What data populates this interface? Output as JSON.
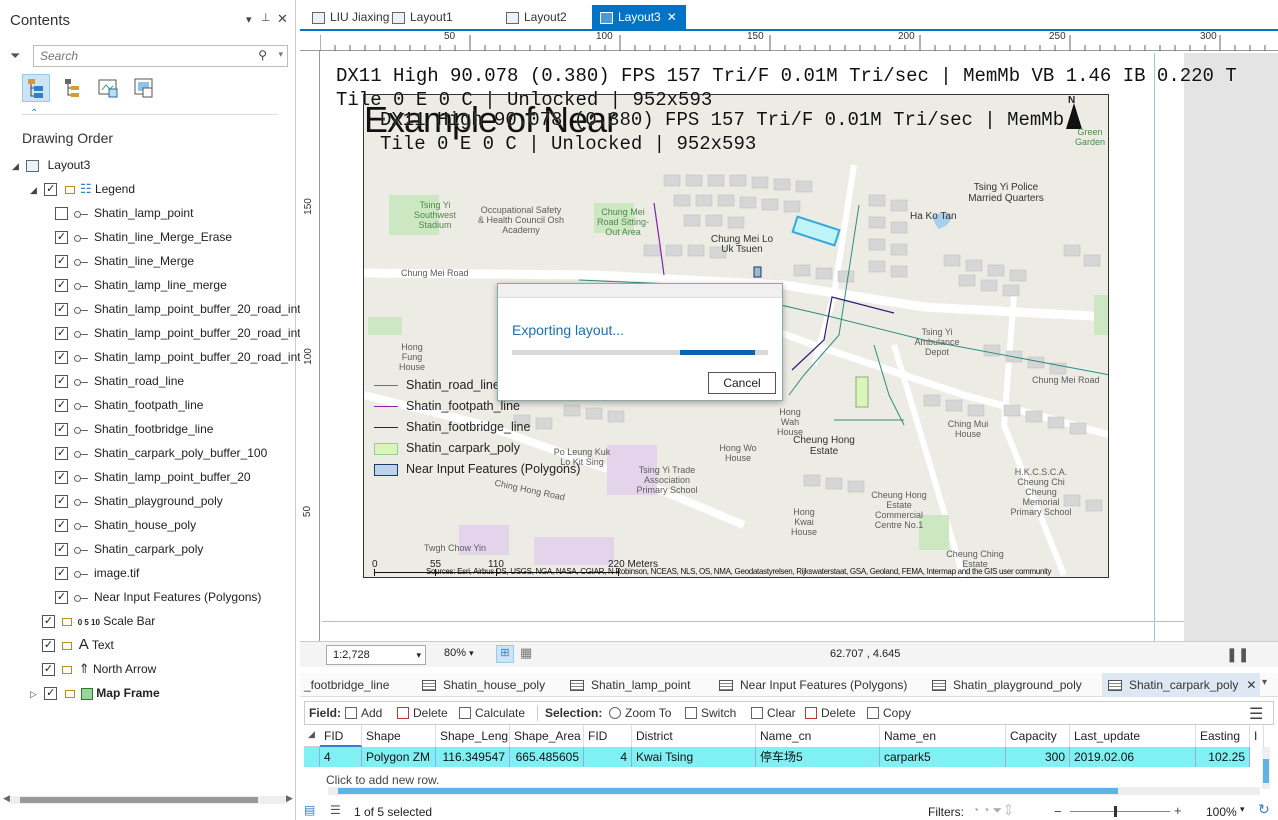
{
  "contents": {
    "title": "Contents",
    "search_placeholder": "Search",
    "section_title": "Drawing Order",
    "root": "Layout3",
    "legend": "Legend",
    "legend_items": [
      {
        "label": "Shatin_lamp_point",
        "checked": false
      },
      {
        "label": "Shatin_line_Merge_Erase",
        "checked": true
      },
      {
        "label": "Shatin_line_Merge",
        "checked": true
      },
      {
        "label": "Shatin_lamp_line_merge",
        "checked": true
      },
      {
        "label": "Shatin_lamp_point_buffer_20_road_inte",
        "checked": true
      },
      {
        "label": "Shatin_lamp_point_buffer_20_road_inte",
        "checked": true
      },
      {
        "label": "Shatin_lamp_point_buffer_20_road_inte",
        "checked": true
      },
      {
        "label": "Shatin_road_line",
        "checked": true
      },
      {
        "label": "Shatin_footpath_line",
        "checked": true
      },
      {
        "label": "Shatin_footbridge_line",
        "checked": true
      },
      {
        "label": "Shatin_carpark_poly_buffer_100",
        "checked": true
      },
      {
        "label": "Shatin_lamp_point_buffer_20",
        "checked": true
      },
      {
        "label": "Shatin_playground_poly",
        "checked": true
      },
      {
        "label": "Shatin_house_poly",
        "checked": true
      },
      {
        "label": "Shatin_carpark_poly",
        "checked": true
      },
      {
        "label": "image.tif",
        "checked": true
      },
      {
        "label": "Near Input Features (Polygons)",
        "checked": true
      }
    ],
    "scale_bar": "Scale Bar",
    "text": "Text",
    "north_arrow": "North Arrow",
    "map_frame": "Map Frame"
  },
  "tabs": [
    "LIU Jiaxing",
    "Layout1",
    "Layout2",
    "Layout3"
  ],
  "ruler": {
    "top": [
      "50",
      "100",
      "150",
      "200",
      "250",
      "300"
    ],
    "left": [
      "150",
      "100",
      "50"
    ]
  },
  "overlay": {
    "fps_line1": "DX11 High 90.078 (0.380) FPS 157 Tri/F 0.01M Tri/sec | MemMb VB 1.46 IB 0.220 T",
    "fps_line2": "Tile 0 E 0 C | Unlocked | 952x593",
    "fps_line3": "DX11 High 90.078 (0.380) FPS 157 Tri/F 0.01M Tri/sec | MemMb",
    "fps_line4": "Tile 0 E 0 C | Unlocked | 952x593"
  },
  "map": {
    "title": "Example of Near",
    "north": "N",
    "places": {
      "tsing_yi_stadium": "Tsing Yi Southwest Stadium",
      "ohs_academy": "Occupational Safety & Health Council Osh Academy",
      "sitting_out": "Chung Mei Road Sitting-Out Area",
      "chung_mei_lo": "Chung Mei Lo Uk Tsuen",
      "police_quarters": "Tsing Yi Police Married Quarters",
      "ha_ko_tan": "Ha Ko Tan",
      "green_garden": "Green Garden",
      "chung_mei_road1": "Chung Mei Road",
      "chung_mei_road2": "Chung Mei Road",
      "ambulance": "Tsing Yi Ambulance Depot",
      "hong_fung": "Hong Fung House",
      "hong_wah": "Hong Wah House",
      "hong_wo": "Hong Wo House",
      "cheung_hong": "Cheung Hong Estate",
      "ching_mui": "Ching Mui House",
      "hkcsca": "H.K.C.S.C.A. Cheung Chi Cheung Memorial Primary School",
      "po_leung_kuk": "Po Leung Kuk Lo Kit Sing",
      "trade_assoc": "Tsing Yi Trade Association Primary School",
      "estate_commercial": "Cheung Hong Estate Commercial Centre No.1",
      "hong_kwai": "Hong Kwai House",
      "cheung_ching": "Cheung Ching Estate",
      "chung_hong_road": "Ching Hong Road",
      "twgh": "Twgh Chow Yin"
    },
    "legend_entries": [
      "Shatin_road_line",
      "Shatin_footpath_line",
      "Shatin_footbridge_line",
      "Shatin_carpark_poly",
      "Near Input Features (Polygons)"
    ],
    "legend_colors": [
      "#2e8f7f",
      "#8b21b5",
      "#2b1b7a",
      "#d9f5b8",
      "#bcd3ea"
    ],
    "scalebar": {
      "ticks": [
        "0",
        "55",
        "110",
        "220 Meters"
      ]
    },
    "sources": "Sources: Esri, Airbus DS, USGS, NGA, NASA, CGIAR, N Robinson, NCEAS, NLS, OS, NMA, Geodatastyrelsen, Rijkswaterstaat, GSA, Geoland, FEMA, Intermap and the GIS user community"
  },
  "dialog": {
    "message": "Exporting layout...",
    "cancel": "Cancel",
    "progress": 0.75
  },
  "status": {
    "scale": "1:2,728",
    "zoom": "80%",
    "coords": "62.707 , 4.645"
  },
  "table_tabs": [
    "_footbridge_line",
    "Shatin_house_poly",
    "Shatin_lamp_point",
    "Near Input Features (Polygons)",
    "Shatin_playground_poly",
    "Shatin_carpark_poly"
  ],
  "toolbar": {
    "field_label": "Field:",
    "add": "Add",
    "delete": "Delete",
    "calculate": "Calculate",
    "selection_label": "Selection:",
    "zoom_to": "Zoom To",
    "switch": "Switch",
    "clear": "Clear",
    "delete2": "Delete",
    "copy": "Copy"
  },
  "table": {
    "columns": [
      "FID",
      "Shape",
      "Shape_Leng",
      "Shape_Area",
      "FID",
      "District",
      "Name_cn",
      "Name_en",
      "Capacity",
      "Last_update",
      "Easting",
      "I"
    ],
    "row": [
      "4",
      "Polygon ZM",
      "116.349547",
      "665.485605",
      "4",
      "Kwai Tsing",
      "停车场5",
      "carpark5",
      "300",
      "2019.02.06",
      "102.25"
    ],
    "add_row": "Click to add new row.",
    "selected": "1 of 5 selected",
    "filters": "Filters:",
    "zoom": "100%"
  }
}
